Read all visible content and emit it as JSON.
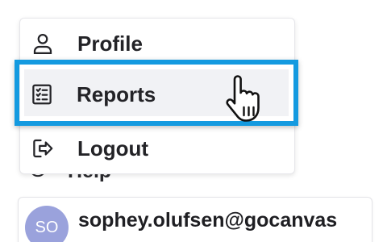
{
  "menu": {
    "items": [
      {
        "label": "Profile",
        "icon": "user-icon"
      },
      {
        "label": "Reports",
        "icon": "checklist-icon",
        "hovered": true
      },
      {
        "label": "Logout",
        "icon": "logout-icon"
      }
    ]
  },
  "background_item": {
    "label": "Help",
    "icon": "help-icon"
  },
  "user": {
    "initials": "SO",
    "email": "sophey.olufsen@gocanvas"
  },
  "colors": {
    "highlight": "#149ae0",
    "avatar": "#9aa2dc",
    "hover_bg": "#f1f2f5"
  }
}
